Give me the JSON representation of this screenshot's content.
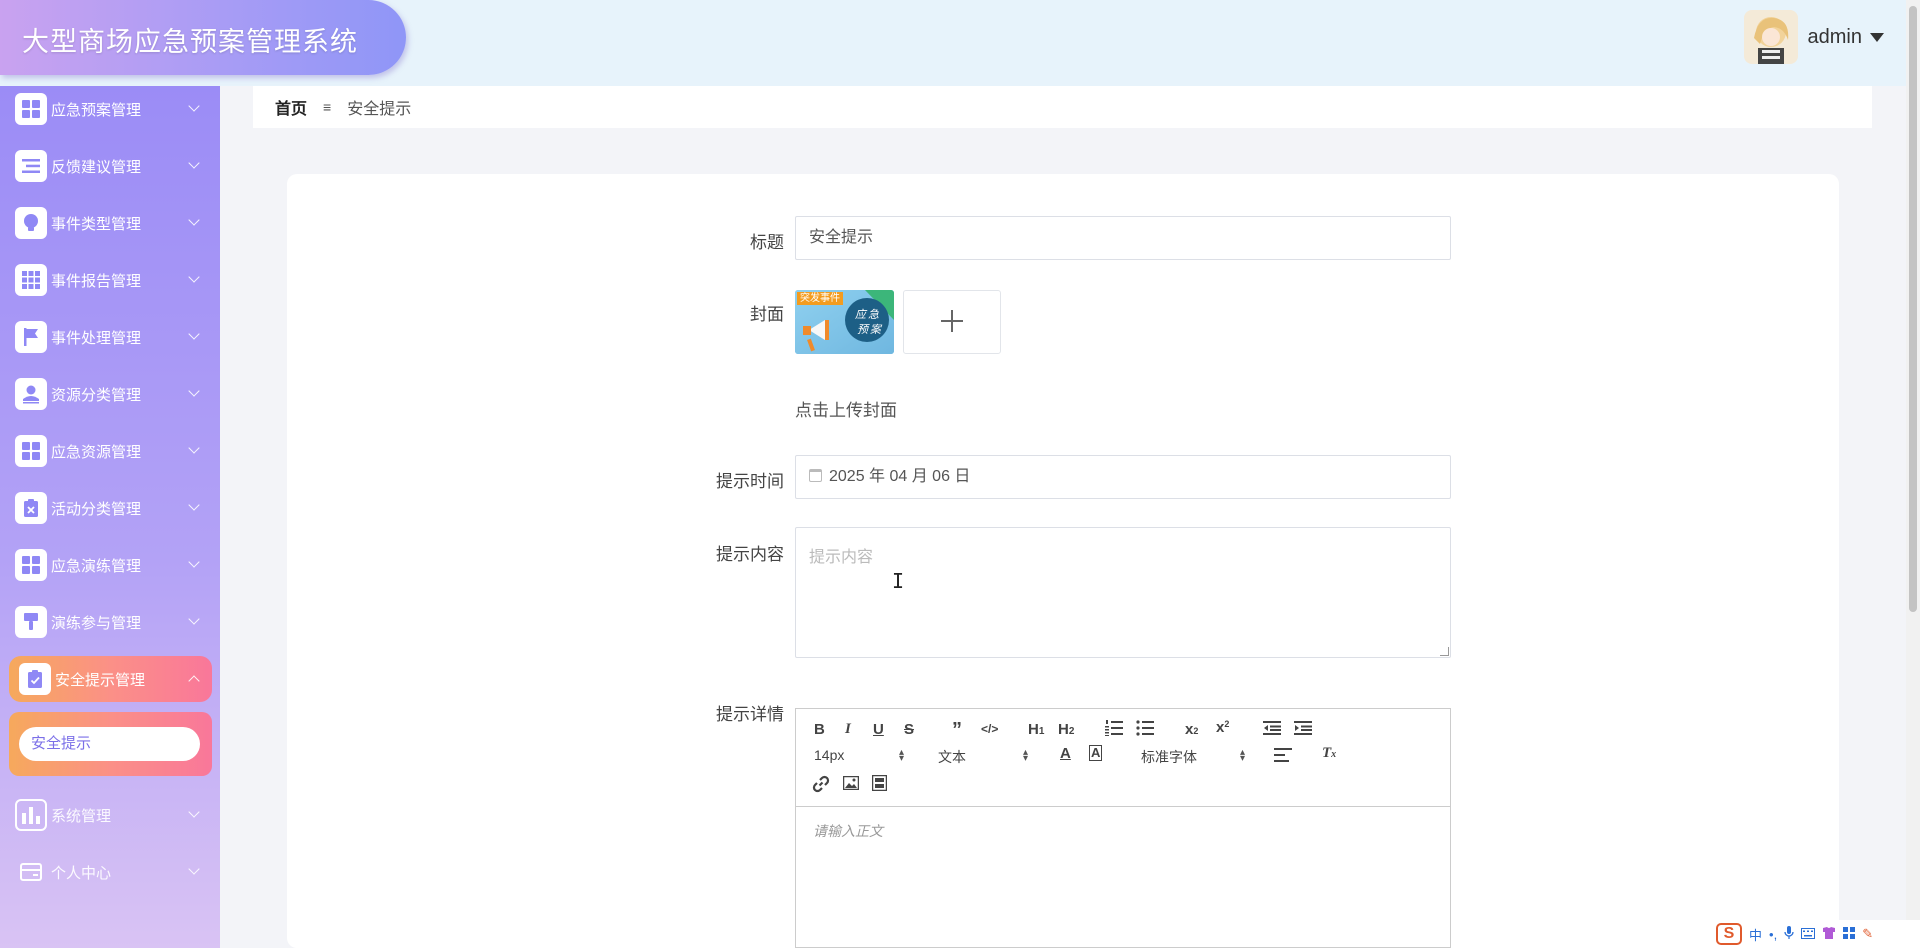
{
  "app": {
    "title": "大型商场应急预案管理系统"
  },
  "user": {
    "name": "admin"
  },
  "sidebar": {
    "items": [
      {
        "label": "应急预案管理",
        "icon": "grid-icon"
      },
      {
        "label": "反馈建议管理",
        "icon": "list-icon"
      },
      {
        "label": "事件类型管理",
        "icon": "bulb-icon"
      },
      {
        "label": "事件报告管理",
        "icon": "apps-icon"
      },
      {
        "label": "事件处理管理",
        "icon": "flag-icon"
      },
      {
        "label": "资源分类管理",
        "icon": "user-icon"
      },
      {
        "label": "应急资源管理",
        "icon": "grid-icon"
      },
      {
        "label": "活动分类管理",
        "icon": "clipboard-x-icon"
      },
      {
        "label": "应急演练管理",
        "icon": "grid-icon"
      },
      {
        "label": "演练参与管理",
        "icon": "brush-icon"
      },
      {
        "label": "安全提示管理",
        "icon": "clipboard-check-icon"
      },
      {
        "label": "系统管理",
        "icon": "bar-chart-icon"
      },
      {
        "label": "个人中心",
        "icon": "wallet-icon"
      }
    ],
    "submenu": {
      "label": "安全提示"
    }
  },
  "breadcrumb": {
    "home": "首页",
    "separator": "≡",
    "current": "安全提示"
  },
  "form": {
    "title_label": "标题",
    "title_value": "安全提示",
    "cover_label": "封面",
    "cover_badge": "突发事件",
    "cover_stamp_line1": "应急",
    "cover_stamp_line2": "预案",
    "upload_hint": "点击上传封面",
    "time_label": "提示时间",
    "time_value": "2025 年 04 月 06 日",
    "content_label": "提示内容",
    "content_placeholder": "提示内容",
    "detail_label": "提示详情"
  },
  "editor": {
    "font_size": "14px",
    "block_type": "文本",
    "font_family": "标准字体",
    "placeholder": "请输入正文"
  },
  "tray": {
    "ime": "中"
  }
}
